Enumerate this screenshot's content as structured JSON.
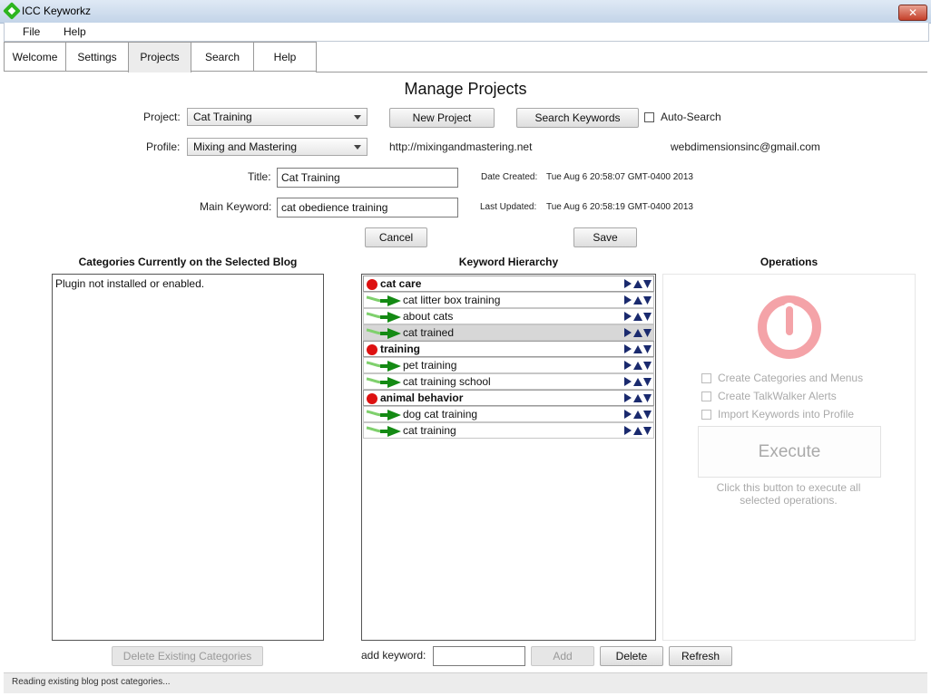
{
  "window": {
    "title": "ICC Keyworkz",
    "close_label": "✕"
  },
  "menu": [
    "File",
    "Help"
  ],
  "tabs": [
    {
      "label": "Welcome",
      "active": false
    },
    {
      "label": "Settings",
      "active": false
    },
    {
      "label": "Projects",
      "active": true
    },
    {
      "label": "Search",
      "active": false
    },
    {
      "label": "Help",
      "active": false
    }
  ],
  "page_title": "Manage Projects",
  "form": {
    "project_label": "Project:",
    "project_value": "Cat Training",
    "new_project": "New Project",
    "search_keywords": "Search Keywords",
    "auto_search": "Auto-Search",
    "profile_label": "Profile:",
    "profile_value": "Mixing and Mastering",
    "profile_url": "http://mixingandmastering.net",
    "profile_email": "webdimensionsinc@gmail.com",
    "title_label": "Title:",
    "title_value": "Cat Training",
    "main_keyword_label": "Main Keyword:",
    "main_keyword_value": "cat obedience training",
    "date_created_label": "Date Created:",
    "date_created_value": "Tue Aug 6 20:58:07 GMT-0400 2013",
    "last_updated_label": "Last Updated:",
    "last_updated_value": "Tue Aug 6 20:58:19 GMT-0400 2013",
    "cancel": "Cancel",
    "save": "Save"
  },
  "categories": {
    "heading": "Categories Currently on the Selected Blog",
    "message": "Plugin not installed or enabled.",
    "delete_button": "Delete Existing Categories"
  },
  "keywords": {
    "heading": "Keyword Hierarchy",
    "rows": [
      {
        "label": "cat care",
        "level": 0,
        "selected": false
      },
      {
        "label": "cat litter box training",
        "level": 1,
        "selected": false
      },
      {
        "label": "about cats",
        "level": 1,
        "selected": false
      },
      {
        "label": "cat trained",
        "level": 1,
        "selected": true
      },
      {
        "label": "training",
        "level": 0,
        "selected": false
      },
      {
        "label": "pet training",
        "level": 1,
        "selected": false
      },
      {
        "label": "cat training school",
        "level": 1,
        "selected": false
      },
      {
        "label": "animal behavior",
        "level": 0,
        "selected": false
      },
      {
        "label": "dog cat training",
        "level": 1,
        "selected": false
      },
      {
        "label": "cat training",
        "level": 1,
        "selected": false
      }
    ],
    "add_label": "add keyword:",
    "add_value": "",
    "add_button": "Add",
    "delete_button": "Delete",
    "refresh_button": "Refresh"
  },
  "operations": {
    "heading": "Operations",
    "options": [
      "Create Categories and Menus",
      "Create TalkWalker Alerts",
      "Import Keywords into Profile"
    ],
    "execute_button": "Execute",
    "hint": "Click this button to execute all selected operations.",
    "power_icon_color": "#f4a3a8"
  },
  "status": "Reading existing blog post categories..."
}
